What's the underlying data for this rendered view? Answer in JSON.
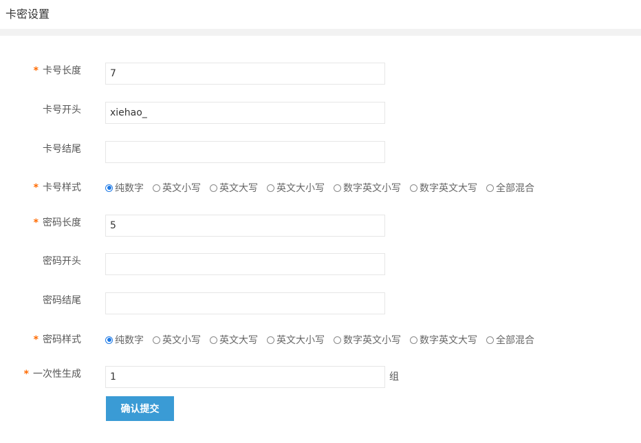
{
  "page": {
    "title": "卡密设置"
  },
  "form": {
    "card_length": {
      "label": "卡号长度",
      "required": "*",
      "value": "7"
    },
    "card_prefix": {
      "label": "卡号开头",
      "value": "xiehao_"
    },
    "card_suffix": {
      "label": "卡号结尾",
      "value": ""
    },
    "card_style": {
      "label": "卡号样式",
      "required": "*",
      "selected": 0,
      "options": [
        "纯数字",
        "英文小写",
        "英文大写",
        "英文大小写",
        "数字英文小写",
        "数字英文大写",
        "全部混合"
      ]
    },
    "pwd_length": {
      "label": "密码长度",
      "required": "*",
      "value": "5"
    },
    "pwd_prefix": {
      "label": "密码开头",
      "value": ""
    },
    "pwd_suffix": {
      "label": "密码结尾",
      "value": ""
    },
    "pwd_style": {
      "label": "密码样式",
      "required": "*",
      "selected": 0,
      "options": [
        "纯数字",
        "英文小写",
        "英文大写",
        "英文大小写",
        "数字英文小写",
        "数字英文大写",
        "全部混合"
      ]
    },
    "batch": {
      "label": "一次性生成",
      "required": "*",
      "value": "1",
      "unit": "组"
    },
    "submit_label": "确认提交"
  },
  "colors": {
    "required_star": "#ff6a00",
    "button_bg": "#3a9bd5",
    "radio_checked": "#1e7ae6"
  }
}
